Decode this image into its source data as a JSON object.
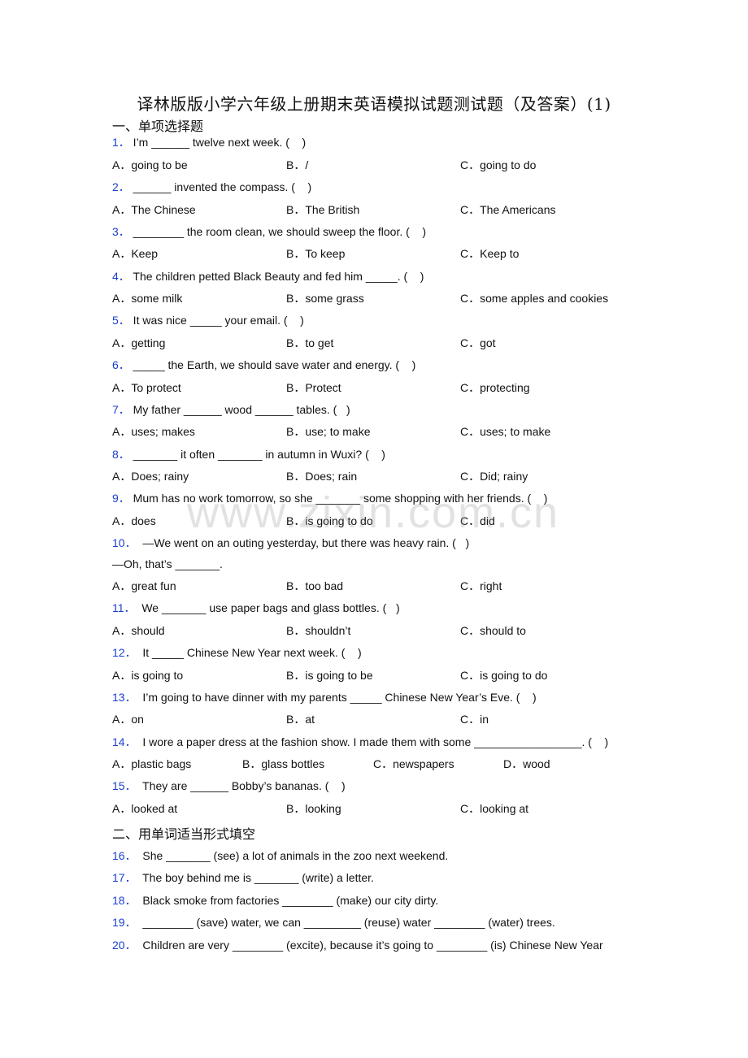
{
  "document": {
    "title": "译林版版小学六年级上册期末英语模拟试题测试题（及答案）(1)",
    "watermark": "www.zixin.com.cn",
    "sections": [
      {
        "heading": "一、单项选择题"
      },
      {
        "heading": "二、用单词适当形式填空"
      }
    ],
    "questions": [
      {
        "num": "1．",
        "text": " I’m ______ twelve next week. (    )",
        "options": [
          "A．going to be",
          "B．/",
          "C．going to do"
        ]
      },
      {
        "num": "2．",
        "text": " ______ invented the compass. (    )",
        "options": [
          "A．The Chinese",
          "B．The British",
          "C．The Americans"
        ]
      },
      {
        "num": "3．",
        "text": " ________ the room clean, we should sweep the floor. (    )",
        "options": [
          "A．Keep",
          "B．To keep",
          "C．Keep to"
        ]
      },
      {
        "num": "4．",
        "text": " The children petted Black Beauty and fed him _____. (    )",
        "options": [
          "A．some milk",
          "B．some grass",
          "C．some apples and cookies"
        ]
      },
      {
        "num": "5．",
        "text": " It was nice _____ your email. (    )",
        "options": [
          "A．getting",
          "B．to get",
          "C．got"
        ]
      },
      {
        "num": "6．",
        "text": " _____ the Earth, we should save water and energy. (    )",
        "options": [
          "A．To protect",
          "B．Protect",
          "C．protecting"
        ]
      },
      {
        "num": "7．",
        "text": " My father ______ wood ______ tables. (   )",
        "options": [
          "A．uses; makes",
          "B．use; to make",
          "C．uses; to make"
        ]
      },
      {
        "num": "8．",
        "text": " _______ it often _______ in autumn in Wuxi? (    )",
        "options": [
          "A．Does; rainy",
          "B．Does; rain",
          "C．Did; rainy"
        ]
      },
      {
        "num": "9．",
        "text": " Mum has no work tomorrow, so she _______ some shopping with her friends. (    )",
        "options": [
          "A．does",
          "B．is going to do",
          "C．did"
        ]
      },
      {
        "num": "10．",
        "text": "  —We went on an outing yesterday, but there was heavy rain. (   )",
        "subline": "—Oh, that’s _______.",
        "options": [
          "A．great fun",
          "B．too bad",
          "C．right"
        ]
      },
      {
        "num": "11．",
        "text": "  We _______ use paper bags and glass bottles. (   )",
        "options": [
          "A．should",
          "B．shouldn’t",
          "C．should to"
        ]
      },
      {
        "num": "12．",
        "text": "  It _____ Chinese New Year next week. (    )",
        "options": [
          "A．is going to",
          "B．is going to be",
          "C．is going to do"
        ]
      },
      {
        "num": "13．",
        "text": "  I’m going to have dinner with my parents _____ Chinese New Year’s Eve. (    )",
        "options": [
          "A．on",
          "B．at",
          "C．in"
        ]
      },
      {
        "num": "14．",
        "text": "  I wore a paper dress at the fashion show. I made them with some _________________. (    )",
        "options": [
          "A．plastic bags",
          "B．glass bottles",
          "C．newspapers",
          "D．wood"
        ]
      },
      {
        "num": "15．",
        "text": "  They are ______ Bobby’s bananas. (    )",
        "options": [
          "A．looked at",
          "B．looking",
          "C．looking at"
        ]
      },
      {
        "num": "16．",
        "text": "  She _______ (see) a lot of animals in the zoo next weekend."
      },
      {
        "num": "17．",
        "text": "  The boy behind me is _______ (write) a letter."
      },
      {
        "num": "18．",
        "text": "  Black smoke from factories ________ (make) our city dirty."
      },
      {
        "num": "19．",
        "text": "  ________ (save) water, we can _________ (reuse) water ________ (water) trees."
      },
      {
        "num": "20．",
        "text": "  Children are very ________ (excite), because it’s going to ________ (is) Chinese New Year"
      }
    ]
  }
}
